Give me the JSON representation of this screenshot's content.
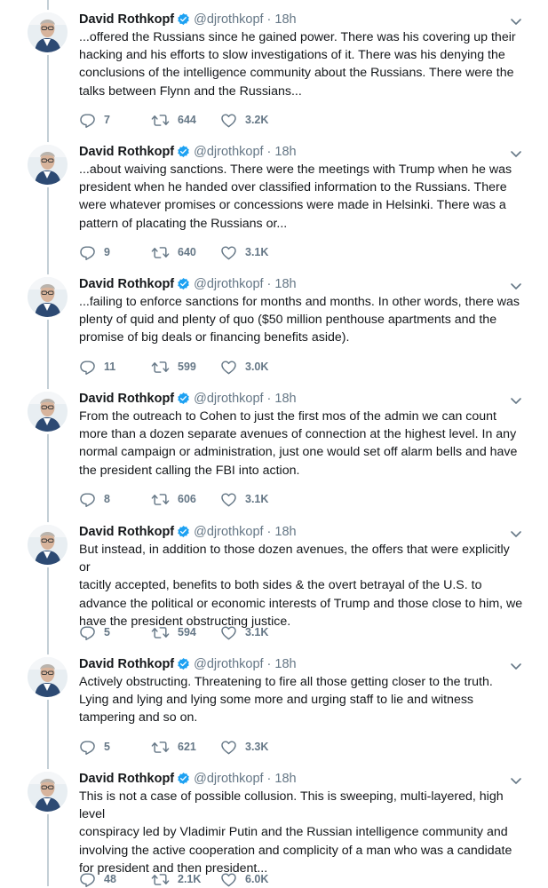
{
  "tweets": [
    {
      "name": "David Rothkopf",
      "handle": "@djrothkopf",
      "dot": "·",
      "time": "18h",
      "text": "...offered the Russians since he gained power.  There was his covering up their\nhacking and his efforts to slow investigations of it.  There was his denying the\nconclusions of the intelligence community about the Russians.  There were the\ntalks between Flynn and the Russians...",
      "replies": "7",
      "retweets": "644",
      "likes": "3.2K"
    },
    {
      "name": "David Rothkopf",
      "handle": "@djrothkopf",
      "dot": "·",
      "time": "18h",
      "text": "...about waiving sanctions.  There were the meetings with Trump when he was\npresident when he handed over classified information to the Russians.  There\nwere whatever promises or concessions were made in Helsinki.  There was a\npattern of placating the Russians or...",
      "replies": "9",
      "retweets": "640",
      "likes": "3.1K"
    },
    {
      "name": "David Rothkopf",
      "handle": "@djrothkopf",
      "dot": "·",
      "time": "18h",
      "text": "...failing to enforce sanctions for months and months.  In other words, there was\nplenty of quid and plenty of quo ($50 million penthouse apartments and the\npromise of big deals or financing benefits aside).",
      "replies": "11",
      "retweets": "599",
      "likes": "3.0K"
    },
    {
      "name": "David Rothkopf",
      "handle": "@djrothkopf",
      "dot": "·",
      "time": "18h",
      "text": "From the outreach to Cohen to just the first mos of the admin we can count\nmore than a dozen separate avenues of connection at the highest level.  In any\nnormal campaign or administration, just one would set off alarm bells and have\nthe president calling the FBI into action.",
      "replies": "8",
      "retweets": "606",
      "likes": "3.1K"
    },
    {
      "name": "David Rothkopf",
      "handle": "@djrothkopf",
      "dot": "·",
      "time": "18h",
      "text": "But instead, in addition to those dozen avenues, the offers that were explicitly or\ntacitly accepted, benefits to both sides & the overt betrayal of the U.S. to\nadvance the political or economic interests of Trump and those close to him, we\nhave the president obstructing justice.",
      "replies": "5",
      "retweets": "594",
      "likes": "3.1K"
    },
    {
      "name": "David Rothkopf",
      "handle": "@djrothkopf",
      "dot": "·",
      "time": "18h",
      "text": "Actively obstructing.  Threatening to fire all those getting closer to the truth.\nLying and lying and lying some more and urging staff to lie and witness\ntampering and so on.",
      "replies": "5",
      "retweets": "621",
      "likes": "3.3K"
    },
    {
      "name": "David Rothkopf",
      "handle": "@djrothkopf",
      "dot": "·",
      "time": "18h",
      "text": "This is not a case of possible collusion.  This is sweeping, multi-layered, high level\nconspiracy led by Vladimir Putin and the Russian intelligence community and\ninvolving the active cooperation and complicity of a man who was a candidate\nfor president and then president...",
      "replies": "48",
      "retweets": "2.1K",
      "likes": "6.0K"
    }
  ],
  "icons": {
    "verified": "verified-badge-icon",
    "chevron": "chevron-down-icon",
    "reply": "reply-icon",
    "retweet": "retweet-icon",
    "like": "heart-icon"
  },
  "colors": {
    "text": "#14171a",
    "secondary": "#657786",
    "verified": "#1da1f2",
    "thread_line": "#c4cfd6"
  }
}
